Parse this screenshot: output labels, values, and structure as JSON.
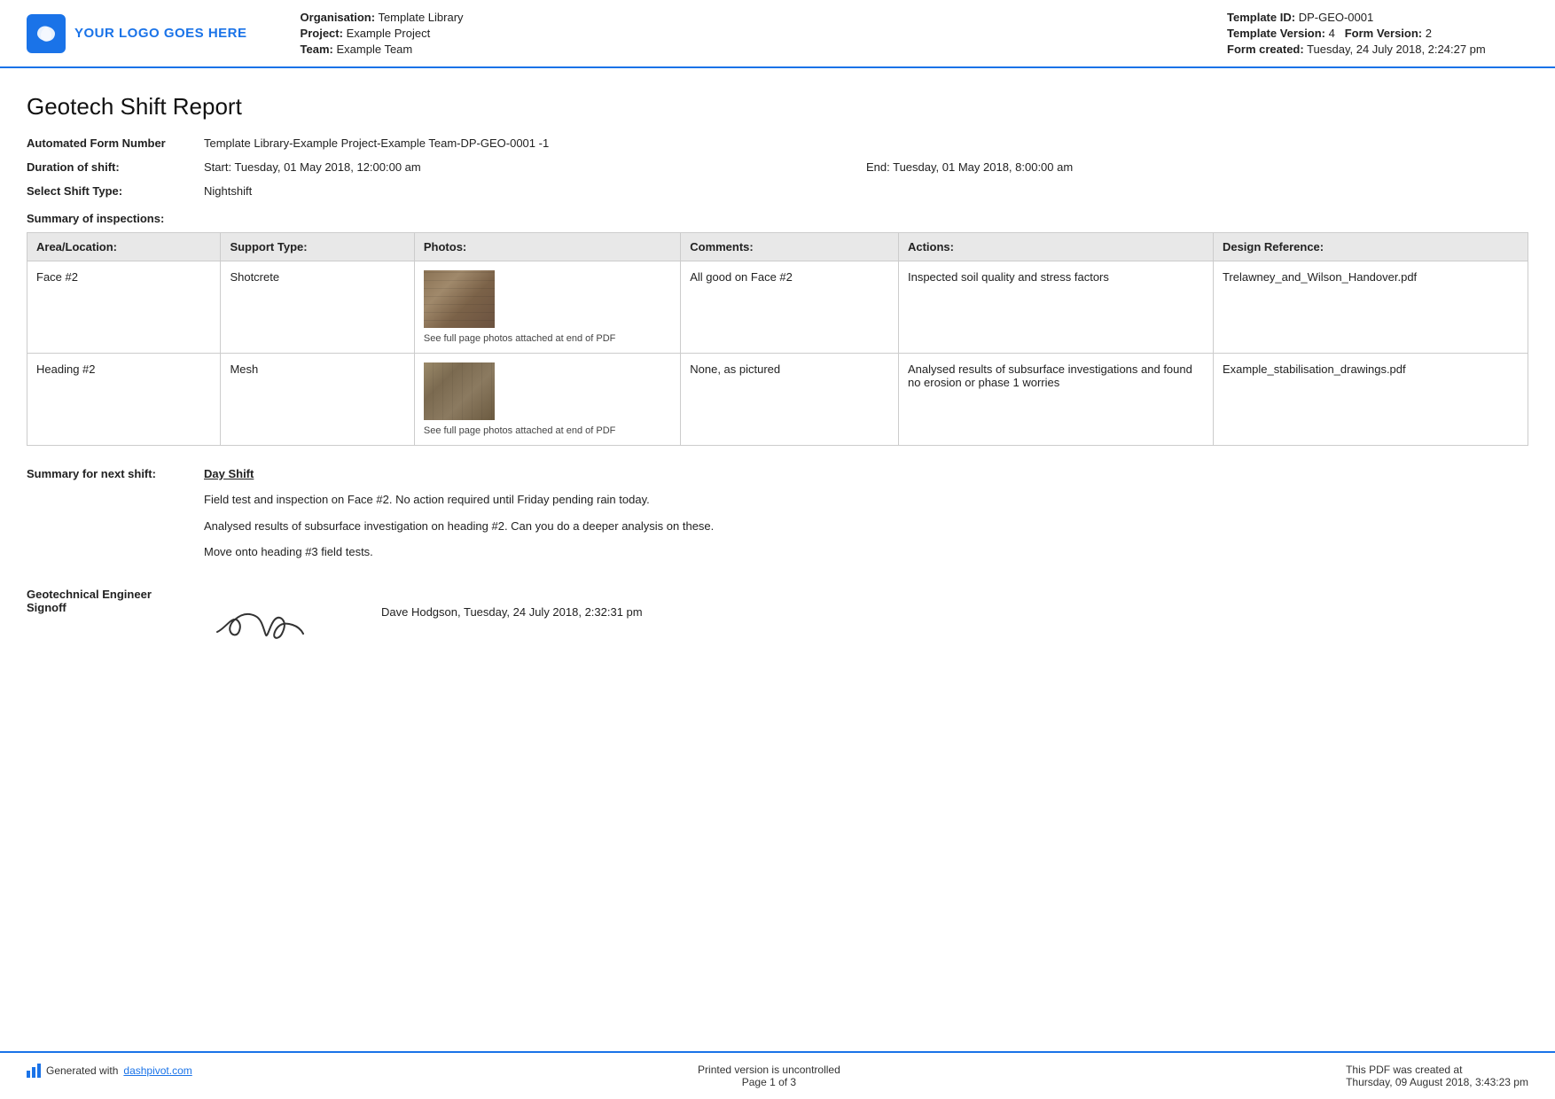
{
  "header": {
    "logo_text": "YOUR LOGO GOES HERE",
    "organisation_label": "Organisation:",
    "organisation_value": "Template Library",
    "project_label": "Project:",
    "project_value": "Example Project",
    "team_label": "Team:",
    "team_value": "Example Team",
    "template_id_label": "Template ID:",
    "template_id_value": "DP-GEO-0001",
    "template_version_label": "Template Version:",
    "template_version_value": "4",
    "form_version_label": "Form Version:",
    "form_version_value": "2",
    "form_created_label": "Form created:",
    "form_created_value": "Tuesday, 24 July 2018, 2:24:27 pm"
  },
  "report": {
    "title": "Geotech Shift Report",
    "automated_form_label": "Automated Form Number",
    "automated_form_value": "Template Library-Example Project-Example Team-DP-GEO-0001   -1",
    "duration_label": "Duration of shift:",
    "duration_start": "Start: Tuesday, 01 May 2018, 12:00:00 am",
    "duration_end": "End: Tuesday, 01 May 2018, 8:00:00 am",
    "shift_type_label": "Select Shift Type:",
    "shift_type_value": "Nightshift",
    "summary_heading": "Summary of inspections:"
  },
  "table": {
    "headers": {
      "area": "Area/Location:",
      "support": "Support Type:",
      "photos": "Photos:",
      "comments": "Comments:",
      "actions": "Actions:",
      "design": "Design Reference:"
    },
    "rows": [
      {
        "area": "Face #2",
        "support": "Shotcrete",
        "photo_caption": "See full page photos attached at end of PDF",
        "comments": "All good on Face #2",
        "actions": "Inspected soil quality and stress factors",
        "design": "Trelawney_and_Wilson_Handover.pdf"
      },
      {
        "area": "Heading #2",
        "support": "Mesh",
        "photo_caption": "See full page photos attached at end of PDF",
        "comments": "None, as pictured",
        "actions": "Analysed results of subsurface investigations and found no erosion or phase 1 worries",
        "design": "Example_stabilisation_drawings.pdf"
      }
    ]
  },
  "next_shift": {
    "label": "Summary for next shift:",
    "title": "Day Shift",
    "paragraphs": [
      "Field test and inspection on Face #2. No action required until Friday pending rain today.",
      "Analysed results of subsurface investigation on heading #2. Can you do a deeper analysis on these.",
      "Move onto heading #3 field tests."
    ]
  },
  "signoff": {
    "label_line1": "Geotechnical Engineer",
    "label_line2": "Signoff",
    "signoff_info": "Dave Hodgson, Tuesday, 24 July 2018, 2:32:31 pm"
  },
  "footer": {
    "generated_text": "Generated with",
    "link_text": "dashpivot.com",
    "center_text": "Printed version is uncontrolled",
    "page_text": "Page 1 of 3",
    "right_line1": "This PDF was created at",
    "right_line2": "Thursday, 09 August 2018, 3:43:23 pm"
  }
}
